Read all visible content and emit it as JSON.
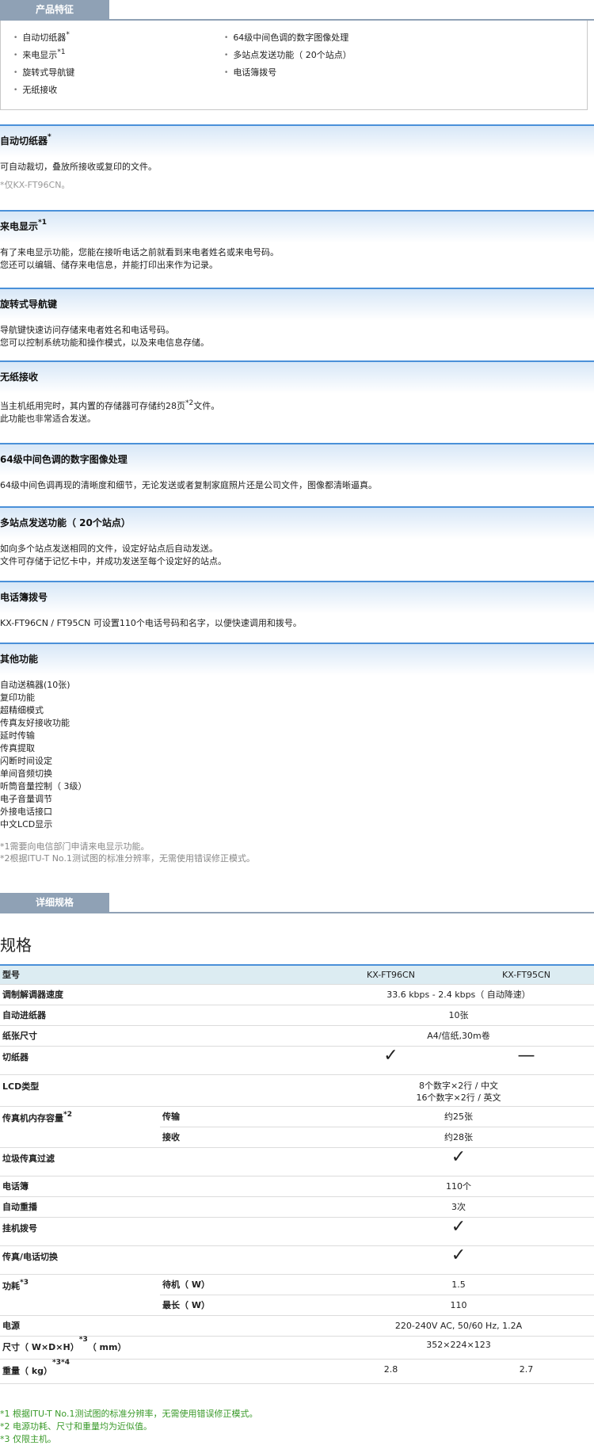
{
  "tab1": "产品特征",
  "features_left": [
    {
      "text": "自动切纸器",
      "sup": "*"
    },
    {
      "text": "来电显示",
      "sup": "*1"
    },
    {
      "text": "旋转式导航键",
      "sup": ""
    },
    {
      "text": "无纸接收",
      "sup": ""
    }
  ],
  "features_right": [
    {
      "text": "64级中间色调的数字图像处理"
    },
    {
      "text": "多站点发送功能（ 20个站点）"
    },
    {
      "text": "电话簿拨号"
    }
  ],
  "sections": {
    "s1": {
      "title": "自动切纸器",
      "sup": "*",
      "body": "可自动裁切，叠放所接收或复印的文件。",
      "note": "*仅KX-FT96CN。"
    },
    "s2": {
      "title": "来电显示",
      "sup": "*1",
      "l1": "有了来电显示功能，您能在接听电话之前就看到来电者姓名或来电号码。",
      "l2": "您还可以编辑、储存来电信息，并能打印出来作为记录。"
    },
    "s3": {
      "title": "旋转式导航键",
      "l1": "导航键快速访问存储来电者姓名和电话号码。",
      "l2": "您可以控制系统功能和操作模式，以及来电信息存储。"
    },
    "s4": {
      "title": "无纸接收",
      "l1a": "当主机纸用完时，其内置的存储器可存储约28页",
      "l1sup": "*2",
      "l1b": "文件。",
      "l2": "此功能也非常适合发送。"
    },
    "s5": {
      "title": "64级中间色调的数字图像处理",
      "l1": "64级中间色调再现的清晰度和细节，无论发送或者复制家庭照片还是公司文件，图像都清晰逼真。"
    },
    "s6": {
      "title": "多站点发送功能（ 20个站点）",
      "l1": "如向多个站点发送相同的文件，设定好站点后自动发送。",
      "l2": "文件可存储于记忆卡中，并成功发送至每个设定好的站点。"
    },
    "s7": {
      "title": "电话簿拨号",
      "l1": "KX-FT96CN / FT95CN 可设置110个电话号码和名字，以便快速调用和拨号。"
    },
    "s8": {
      "title": "其他功能",
      "items": [
        "自动送稿器(10张)",
        "复印功能",
        "超精细模式",
        "传真友好接收功能",
        "延时传输",
        "传真提取",
        "闪断时间设定",
        "单间音频切换",
        "听筒音量控制（ 3级）",
        "电子音量调节",
        "外接电话接口",
        "中文LCD显示"
      ],
      "foot1": "*1需要向电信部门申请来电显示功能。",
      "foot2": "*2根据ITU-T No.1测试图的标准分辨率，无需使用错误修正模式。"
    }
  },
  "tab2": "详细规格",
  "spec_title": "规格",
  "spec": {
    "model_label": "型号",
    "model1": "KX-FT96CN",
    "model2": "KX-FT95CN",
    "modem": "调制解调器速度",
    "modem_v": "33.6 kbps - 2.4 kbps（ 自动降速）",
    "adf": "自动进纸器",
    "adf_v": "10张",
    "paper": "纸张尺寸",
    "paper_v": "A4/信纸,30m卷",
    "cutter": "切纸器",
    "check": "✓",
    "dash": "—",
    "lcd": "LCD类型",
    "lcd_v1": "8个数字×2行 / 中文",
    "lcd_v2": "16个数字×2行 / 英文",
    "mem": "传真机内存容量",
    "mem_sup": "*2",
    "mem_tx": "传输",
    "mem_tx_v": "约25张",
    "mem_rx": "接收",
    "mem_rx_v": "约28张",
    "junk": "垃圾传真过滤",
    "book": "电话簿",
    "book_v": "110个",
    "redial": "自动重播",
    "redial_v": "3次",
    "onhook": "挂机拨号",
    "switch": "传真/电话切换",
    "power": "功耗",
    "power_sup": "*3",
    "standby": "待机（ W）",
    "standby_v": "1.5",
    "max": "最长（ W）",
    "max_v": "110",
    "supply": "电源",
    "supply_v": "220-240V AC, 50/60 Hz, 1.2A",
    "size": "尺寸（ W×D×H）",
    "size_sup": "*3",
    "size_unit": "（ mm）",
    "size_v": "352×224×123",
    "weight": "重量（ kg）",
    "weight_sup": "*3*4",
    "weight1": "2.8",
    "weight2": "2.7"
  },
  "footnotes": [
    "*1 根据ITU-T No.1测试图的标准分辨率，无需使用错误修正模式。",
    "*2 电源功耗、尺寸和重量均为近似值。",
    "*3 仅限主机。"
  ]
}
